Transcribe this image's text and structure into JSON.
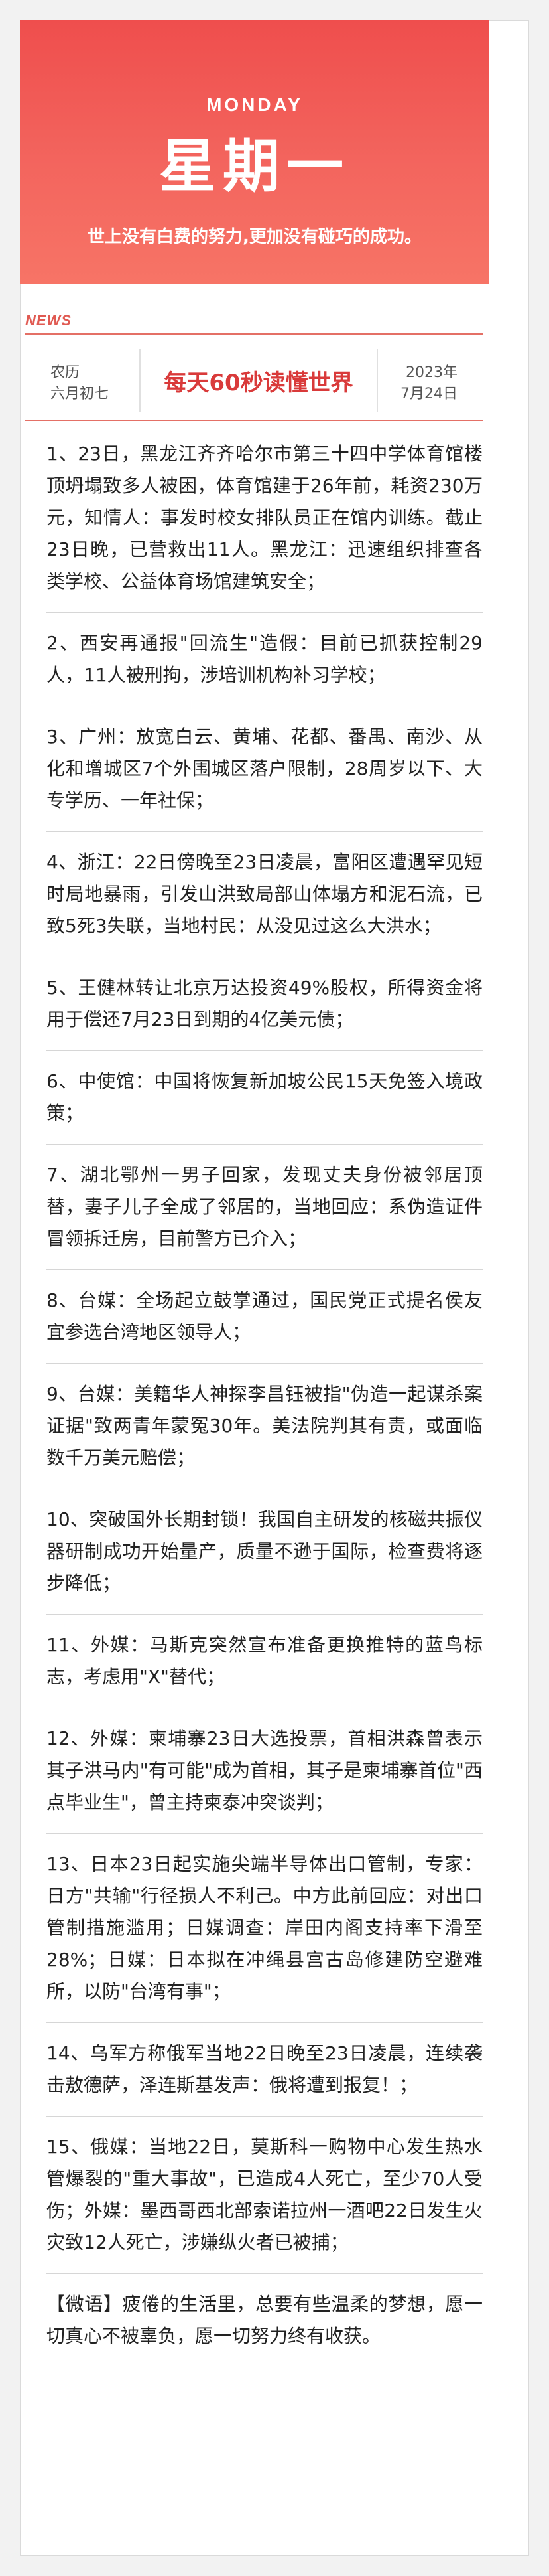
{
  "banner": {
    "weekday_en": "MONDAY",
    "weekday_cn": "星期一",
    "quote": "世上没有白费的努力,更加没有碰巧的成功。",
    "color_top": "#ef4e4d",
    "color_bottom": "#f77466"
  },
  "news_label": "NEWS",
  "date": {
    "lunar_1": "农历",
    "lunar_2": "六月初七",
    "title": "每天60秒读懂世界",
    "greg_1": "2023年",
    "greg_2": "7月24日"
  },
  "items": [
    "1、23日，黑龙江齐齐哈尔市第三十四中学体育馆楼顶坍塌致多人被困，体育馆建于26年前，耗资230万元，知情人：事发时校女排队员正在馆内训练。截止23日晚，已营救出11人。黑龙江：迅速组织排查各类学校、公益体育场馆建筑安全；",
    "2、西安再通报\"回流生\"造假：目前已抓获控制29人，11人被刑拘，涉培训机构补习学校；",
    "3、广州：放宽白云、黄埔、花都、番禺、南沙、从化和增城区7个外围城区落户限制，28周岁以下、大专学历、一年社保；",
    "4、浙江：22日傍晚至23日凌晨，富阳区遭遇罕见短时局地暴雨，引发山洪致局部山体塌方和泥石流，已致5死3失联，当地村民：从没见过这么大洪水；",
    "5、王健林转让北京万达投资49%股权，所得资金将用于偿还7月23日到期的4亿美元债；",
    "6、中使馆：中国将恢复新加坡公民15天免签入境政策；",
    "7、湖北鄂州一男子回家，发现丈夫身份被邻居顶替，妻子儿子全成了邻居的，当地回应：系伪造证件冒领拆迁房，目前警方已介入；",
    "8、台媒：全场起立鼓掌通过，国民党正式提名侯友宜参选台湾地区领导人；",
    "9、台媒：美籍华人神探李昌钰被指\"伪造一起谋杀案证据\"致两青年蒙冤30年。美法院判其有责，或面临数千万美元赔偿；",
    "10、突破国外长期封锁！我国自主研发的核磁共振仪器研制成功开始量产，质量不逊于国际，检查费将逐步降低；",
    "11、外媒：马斯克突然宣布准备更换推特的蓝鸟标志，考虑用\"X\"替代；",
    "12、外媒：柬埔寨23日大选投票，首相洪森曾表示其子洪马内\"有可能\"成为首相，其子是柬埔寨首位\"西点毕业生\"，曾主持柬泰冲突谈判；",
    "13、日本23日起实施尖端半导体出口管制，专家：日方\"共输\"行径损人不利己。中方此前回应：对出口管制措施滥用；日媒调查：岸田内阁支持率下滑至28%；日媒：日本拟在冲绳县宫古岛修建防空避难所，以防\"台湾有事\"；",
    "14、乌军方称俄军当地22日晚至23日凌晨，连续袭击敖德萨，泽连斯基发声：俄将遭到报复！；",
    "15、俄媒：当地22日，莫斯科一购物中心发生热水管爆裂的\"重大事故\"，已造成4人死亡，至少70人受伤；外媒：墨西哥西北部索诺拉州一酒吧22日发生火灾致12人死亡，涉嫌纵火者已被捕；",
    "【微语】疲倦的生活里，总要有些温柔的梦想，愿一切真心不被辜负，愿一切努力终有收获。"
  ]
}
